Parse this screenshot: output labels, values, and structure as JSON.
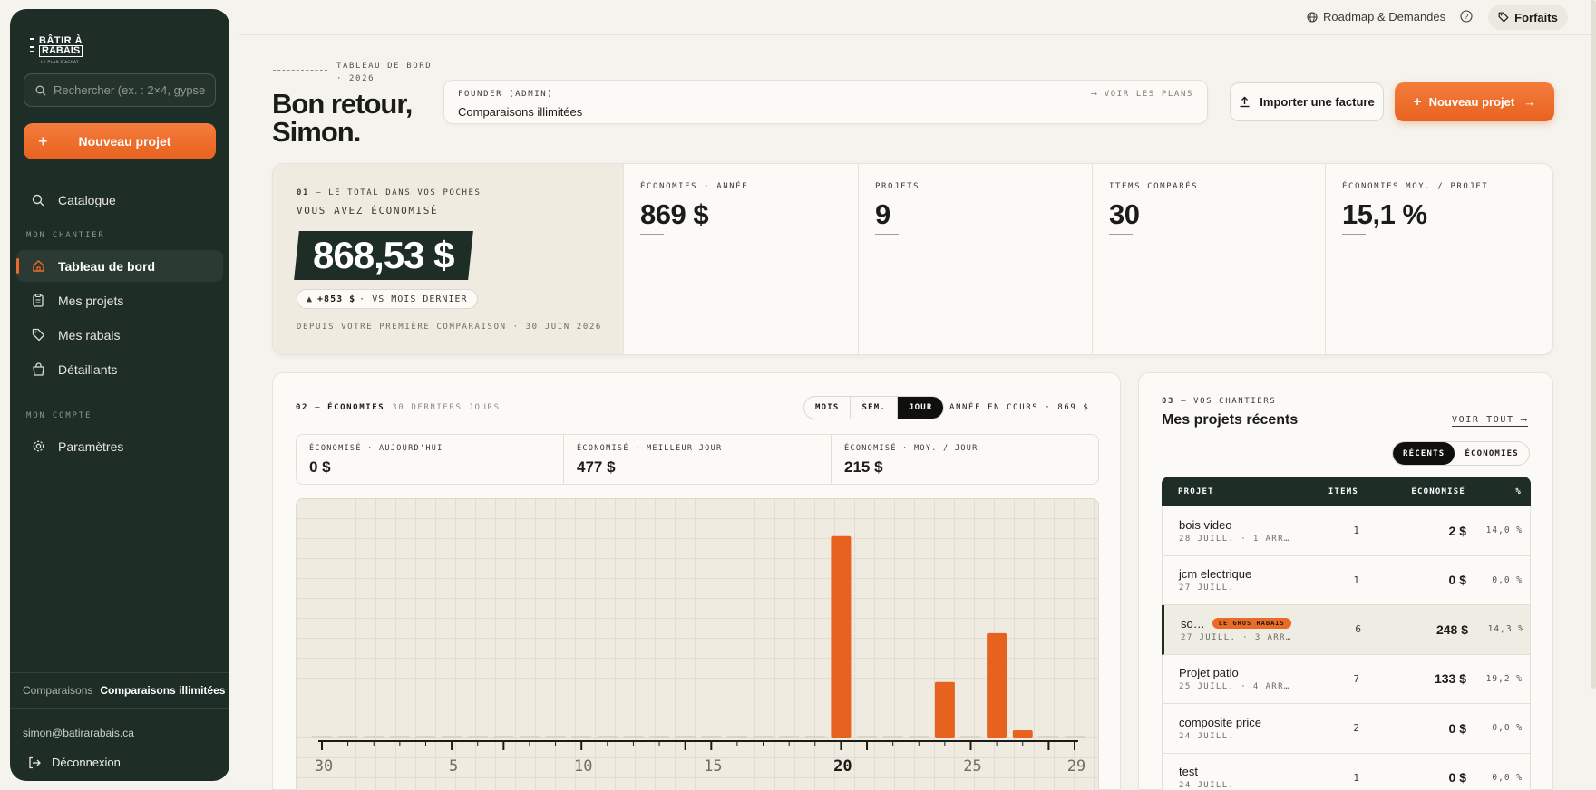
{
  "brand": {
    "line1": "BÂTIR À",
    "line2": "RABAIS",
    "line3": "LE PLAN D'ACHAT"
  },
  "sidebar": {
    "search_placeholder": "Rechercher (ex. : 2×4, gypse",
    "new_project": "Nouveau projet",
    "catalogue": "Catalogue",
    "section_chantier": "MON CHANTIER",
    "items": [
      {
        "label": "Tableau de bord",
        "icon": "home-icon"
      },
      {
        "label": "Mes projets",
        "icon": "clipboard-icon"
      },
      {
        "label": "Mes rabais",
        "icon": "tag-icon"
      },
      {
        "label": "Détaillants",
        "icon": "bag-icon"
      }
    ],
    "section_compte": "MON COMPTE",
    "settings": "Paramètres",
    "plan_label": "Comparaisons",
    "plan_value": "Comparaisons illimitées",
    "email": "simon@batirarabais.ca",
    "logout": "Déconnexion"
  },
  "topbar": {
    "roadmap": "Roadmap & Demandes",
    "forfaits": "Forfaits"
  },
  "header": {
    "eyebrow": "TABLEAU DE BORD · 2026",
    "greeting_line1": "Bon retour,",
    "greeting_line2": "Simon.",
    "plan_role": "FOUNDER (ADMIN)",
    "plan_desc": "Comparaisons illimitées",
    "plan_link": "VOIR LES PLANS",
    "import": "Importer une facture",
    "new_project": "Nouveau projet"
  },
  "kpis": {
    "hero_eyebrow_num": "01",
    "hero_eyebrow": "LE TOTAL DANS VOS POCHES",
    "hero_sub": "VOUS AVEZ ÉCONOMISÉ",
    "hero_amount": "868,53 $",
    "hero_delta_value": "+853 $",
    "hero_delta_label": "· VS MOIS DERNIER",
    "hero_since": "DEPUIS VOTRE PREMIÈRE COMPARAISON · 30 JUIN 2026",
    "cards": [
      {
        "label": "ÉCONOMIES · ANNÉE",
        "value": "869 $"
      },
      {
        "label": "PROJETS",
        "value": "9"
      },
      {
        "label": "ITEMS COMPARÉS",
        "value": "30"
      },
      {
        "label": "ÉCONOMIES MOY. / PROJET",
        "value": "15,1 %"
      }
    ]
  },
  "savings": {
    "num": "02",
    "title": "ÉCONOMIES",
    "subtitle": "30 DERNIERS JOURS",
    "tabs": [
      "MOIS",
      "SEM.",
      "JOUR"
    ],
    "active_tab": "JOUR",
    "year_info": "ANNÉE EN COURS · 869 $",
    "stats": [
      {
        "label": "ÉCONOMISÉ · AUJOURD'HUI",
        "value": "0 $"
      },
      {
        "label": "ÉCONOMISÉ · MEILLEUR JOUR",
        "value": "477 $"
      },
      {
        "label": "ÉCONOMISÉ · MOY. / JOUR",
        "value": "215 $"
      }
    ]
  },
  "chart_data": {
    "type": "bar",
    "x": [
      30,
      1,
      2,
      3,
      4,
      5,
      6,
      7,
      8,
      9,
      10,
      11,
      12,
      13,
      14,
      15,
      16,
      17,
      18,
      19,
      20,
      21,
      22,
      23,
      24,
      25,
      26,
      27,
      28,
      29
    ],
    "values": [
      0,
      0,
      0,
      0,
      0,
      0,
      0,
      0,
      0,
      0,
      0,
      0,
      0,
      0,
      0,
      0,
      0,
      0,
      0,
      0,
      477,
      0,
      0,
      0,
      133,
      0,
      248,
      15,
      0,
      0
    ],
    "tick_labels": [
      "30",
      "5",
      "10",
      "15",
      "20",
      "25",
      "29"
    ],
    "tick_index": [
      0,
      5,
      10,
      15,
      20,
      25,
      29
    ],
    "highlight_tick": "20",
    "ylim": [
      0,
      500
    ],
    "grid": true,
    "bar_color": "#e8621f"
  },
  "projects": {
    "num": "03",
    "eyebrow": "VOS CHANTIERS",
    "title": "Mes projets récents",
    "voir_tout": "VOIR TOUT",
    "tabs": [
      "RÉCENTS",
      "ÉCONOMIES"
    ],
    "columns": [
      "PROJET",
      "ITEMS",
      "ÉCONOMISÉ",
      "%"
    ],
    "rows": [
      {
        "name": "bois video",
        "meta": "28 JUILL. · 1 ARR…",
        "items": "1",
        "saved": "2 $",
        "pct": "14,0 %"
      },
      {
        "name": "jcm electrique",
        "meta": "27 JUILL.",
        "items": "1",
        "saved": "0 $",
        "pct": "0,0 %"
      },
      {
        "name": "so…",
        "badge": "LE GROS RABAIS",
        "meta": "27 JUILL. · 3 ARR…",
        "items": "6",
        "saved": "248 $",
        "pct": "14,3 %"
      },
      {
        "name": "Projet patio",
        "meta": "25 JUILL. · 4 ARR…",
        "items": "7",
        "saved": "133 $",
        "pct": "19,2 %"
      },
      {
        "name": "composite price",
        "meta": "24 JUILL.",
        "items": "2",
        "saved": "0 $",
        "pct": "0,0 %"
      },
      {
        "name": "test",
        "meta": "24 JUILL.",
        "items": "1",
        "saved": "0 $",
        "pct": "0,0 %"
      }
    ]
  }
}
